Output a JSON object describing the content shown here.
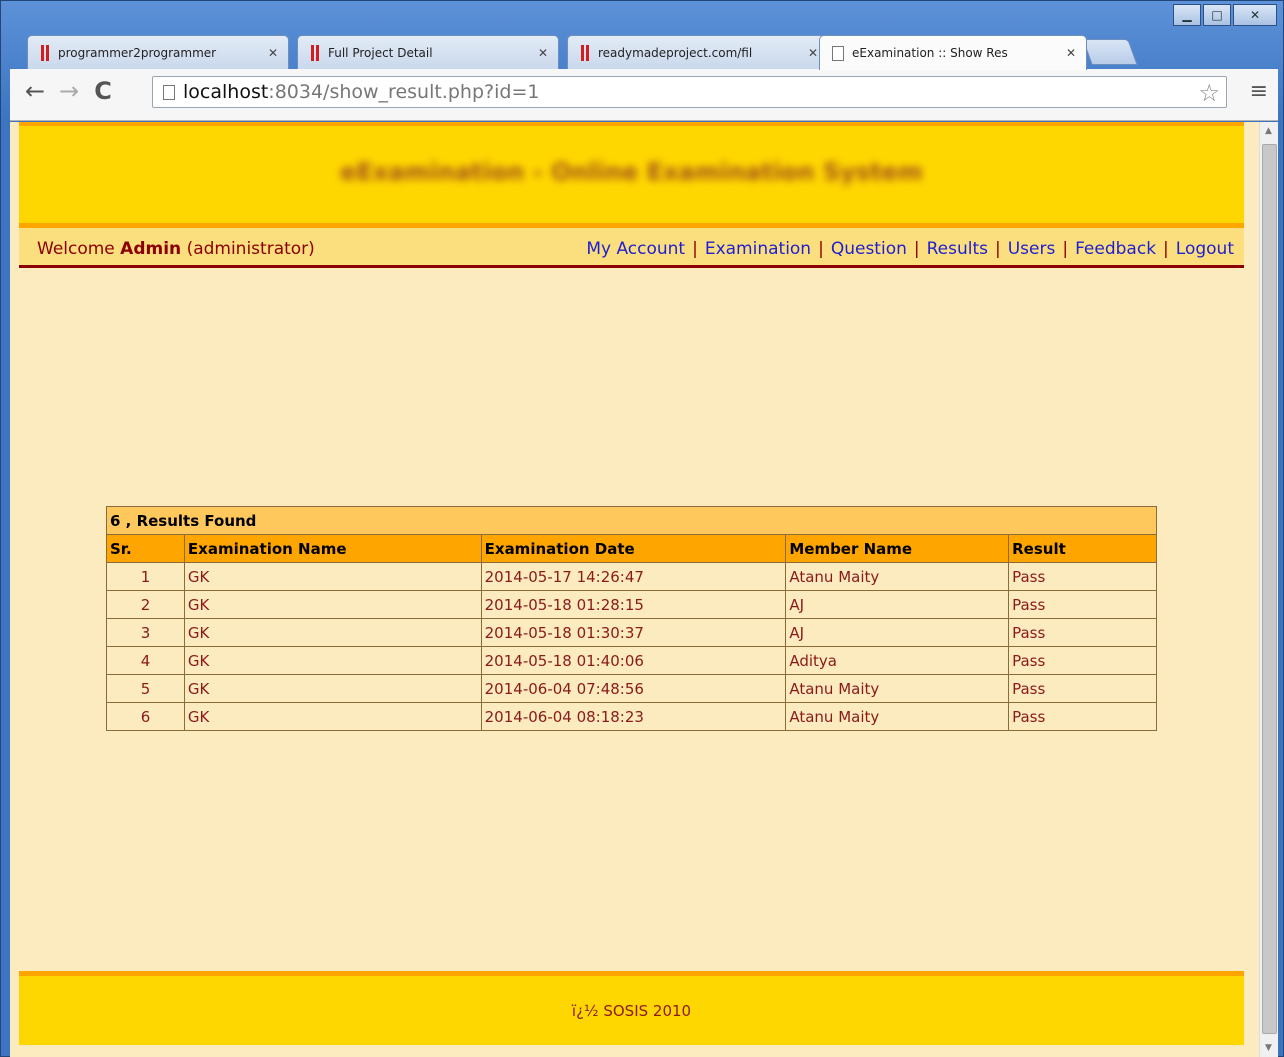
{
  "tabs": [
    {
      "title": "programmer2programmer",
      "icon": "red-bars-icon"
    },
    {
      "title": "Full Project Detail",
      "icon": "red-bars-icon"
    },
    {
      "title": "readymadeproject.com/fil",
      "icon": "red-bars-icon"
    },
    {
      "title": "eExamination :: Show Res",
      "icon": "page-icon",
      "active": true
    }
  ],
  "address": {
    "host": "localhost",
    "rest": ":8034/show_result.php?id=1"
  },
  "header": {
    "title": "eExamination - Online Examination System"
  },
  "nav": {
    "welcome_prefix": "Welcome",
    "user": "Admin",
    "role": "(administrator)",
    "links": [
      "My Account",
      "Examination",
      "Question",
      "Results",
      "Users",
      "Feedback",
      "Logout"
    ],
    "separator": "|"
  },
  "results": {
    "summary": "6 , Results Found",
    "columns": [
      "Sr.",
      "Examination Name",
      "Examination Date",
      "Member Name",
      "Result"
    ],
    "rows": [
      [
        "1",
        "GK",
        "2014-05-17 14:26:47",
        "Atanu Maity",
        "Pass"
      ],
      [
        "2",
        "GK",
        "2014-05-18 01:28:15",
        "AJ",
        "Pass"
      ],
      [
        "3",
        "GK",
        "2014-05-18 01:30:37",
        "AJ",
        "Pass"
      ],
      [
        "4",
        "GK",
        "2014-05-18 01:40:06",
        "Aditya",
        "Pass"
      ],
      [
        "5",
        "GK",
        "2014-06-04 07:48:56",
        "Atanu Maity",
        "Pass"
      ],
      [
        "6",
        "GK",
        "2014-06-04 08:18:23",
        "Atanu Maity",
        "Pass"
      ]
    ]
  },
  "footer": {
    "text": "ï¿½ SOSIS 2010"
  },
  "colors": {
    "header_bg": "#ffd700",
    "accent": "#ffa500",
    "page_bg": "#fbebbe",
    "text": "#8b1a1a",
    "link": "#2020d0"
  }
}
